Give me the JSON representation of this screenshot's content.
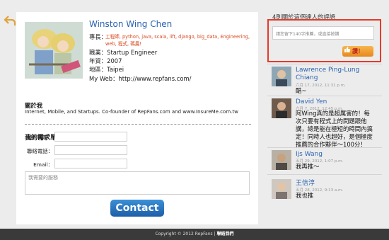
{
  "profile": {
    "name": "Winston Wing Chen",
    "skills_label": "專長：",
    "skills": [
      "工程師",
      "python",
      "java",
      "scala",
      "lift",
      "django",
      "big_data",
      "Engineering",
      "web",
      "程式",
      "碼農"
    ],
    "job_label": "職業：",
    "job": "Startup Engineer",
    "years_label": "年資：",
    "years": "2007",
    "region_label": "地區：",
    "region": "Taipei",
    "web_label": "My Web：",
    "web": "http://www.repfans.com/",
    "about_heading": "關於我",
    "about_text": "Internet, Mobile, and Startups. Co-founder of RepFans.com and www.InsureMe.com.tw"
  },
  "form": {
    "heading": "我的需求單",
    "name_label": "我的稱呼：",
    "phone_label": "聯絡電話：",
    "email_label": "Email：",
    "service_placeholder": "我需要的服務",
    "contact_button": "Contact"
  },
  "reviews": {
    "title_count": "4",
    "title_text": "則關於這個達人的評語",
    "comment_placeholder": "請您留下140字推薦，或直接按讚",
    "like_label": "讚！",
    "items": [
      {
        "name_line1": "Lawrence Ping-Lung",
        "name_line2": "Chiang",
        "date": "六月 17, 2012, 11:31 p.m.",
        "body": "酷~"
      },
      {
        "name_line1": "David Yen",
        "date": "六月 7, 2012, 12:45 p.m.",
        "body_lines": [
          "阿Wing真的是超厲害的！每",
          "次只要有程式上的問題跟他",
          "講，總是能在極短的時間內搞",
          "定！同時人也超好，是個極度",
          "推薦的合作夥伴～100分！"
        ]
      },
      {
        "name_line1": "Ijs Wang",
        "date": "五月 29, 2012, 1:07 p.m.",
        "body": "我再推～"
      },
      {
        "name_line1": "王信淳",
        "date": "五月 28, 2012, 9:13 a.m.",
        "body": "我也推"
      }
    ]
  },
  "footer": {
    "copyright": "Copyright © 2012 RepFans",
    "separator": "|",
    "contact_link": "聯絡我們"
  },
  "icons": {
    "back": "back-arrow-icon",
    "like": "thumbs-up-icon"
  },
  "colors": {
    "accent_blue": "#2a63b0",
    "tag_orange": "#d9481e",
    "highlight_red": "#e53a2a",
    "like_orange": "#f0a030",
    "footer_bg": "#3a3a3a"
  }
}
